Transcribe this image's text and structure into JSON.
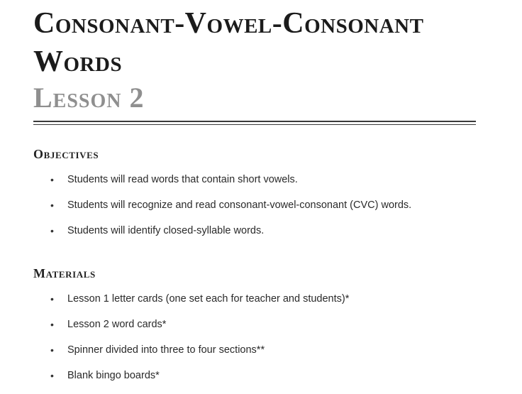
{
  "header": {
    "title": "Consonant-Vowel-Consonant Words",
    "lesson": "Lesson 2"
  },
  "objectives": {
    "heading": "Objectives",
    "items": [
      "Students will read words that contain short vowels.",
      "Students will recognize and read consonant-vowel-consonant (CVC) words.",
      "Students will identify closed-syllable words."
    ]
  },
  "materials": {
    "heading": "Materials",
    "items": [
      "Lesson 1 letter cards (one set each for teacher and students)*",
      "Lesson 2 word cards*",
      "Spinner divided into three to four sections**",
      "Blank bingo boards*"
    ]
  },
  "bullet_glyph": "•"
}
